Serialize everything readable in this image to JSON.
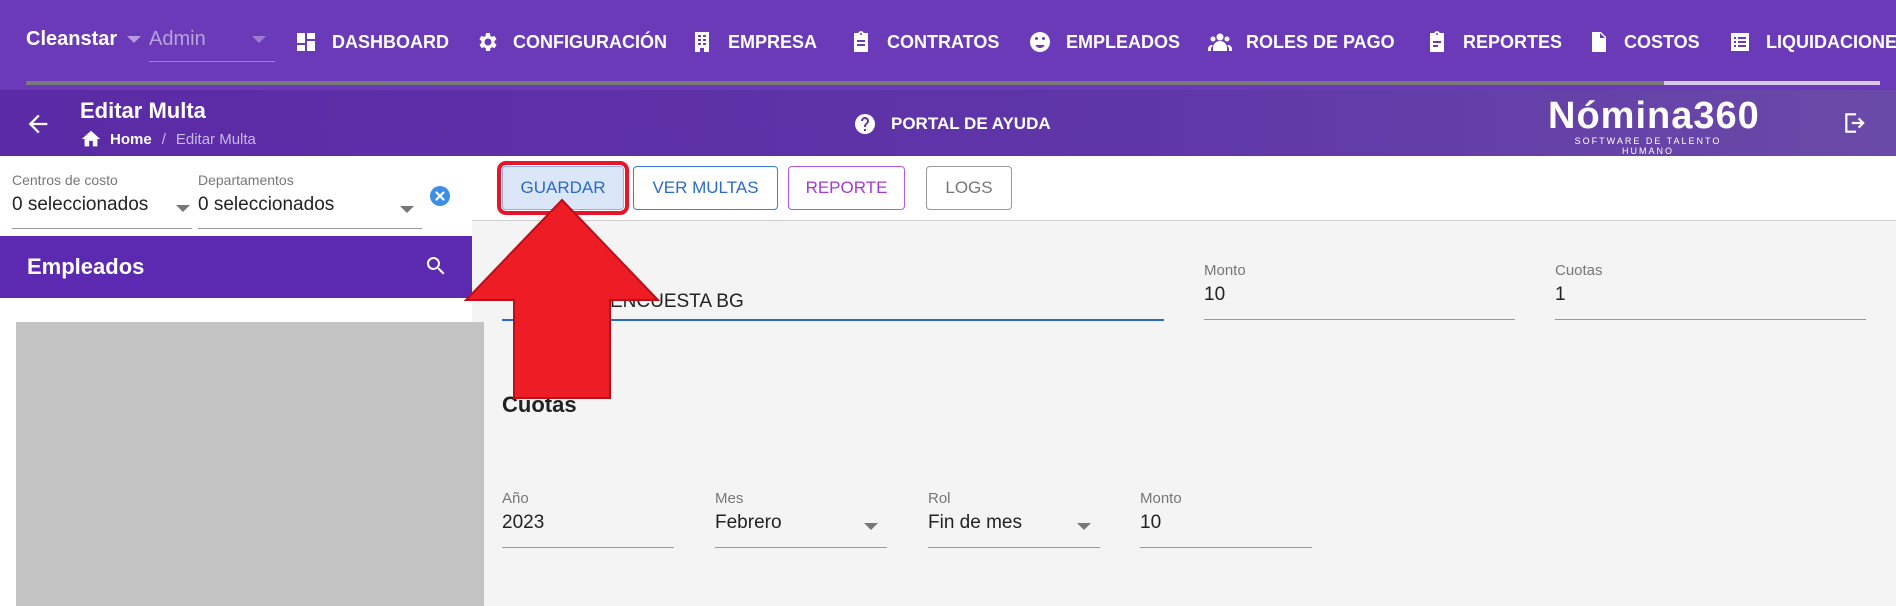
{
  "topbar": {
    "company": "Cleanstar",
    "role": "Admin",
    "menu": [
      {
        "label": "DASHBOARD",
        "icon": "dashboard-icon"
      },
      {
        "label": "CONFIGURACIÓN",
        "icon": "gear-icon"
      },
      {
        "label": "EMPRESA",
        "icon": "building-icon"
      },
      {
        "label": "CONTRATOS",
        "icon": "clipboard-icon"
      },
      {
        "label": "EMPLEADOS",
        "icon": "face-icon"
      },
      {
        "label": "ROLES DE PAGO",
        "icon": "group-icon"
      },
      {
        "label": "REPORTES",
        "icon": "report-icon"
      },
      {
        "label": "COSTOS",
        "icon": "dollar-file-icon"
      },
      {
        "label": "LIQUIDACIONE",
        "icon": "list-icon"
      }
    ]
  },
  "subbar": {
    "title": "Editar Multa",
    "breadcrumb_home": "Home",
    "breadcrumb_separator": "/",
    "breadcrumb_current": "Editar Multa",
    "help": "PORTAL DE AYUDA",
    "brand_name": "Nómina360",
    "brand_tagline": "SOFTWARE DE TALENTO HUMANO"
  },
  "filters": {
    "centros_label": "Centros de costo",
    "centros_value": "0 seleccionados",
    "departamentos_label": "Departamentos",
    "departamentos_value": "0 seleccionados"
  },
  "employees": {
    "title": "Empleados"
  },
  "toolbar": {
    "guardar": "GUARDAR",
    "ver_multas": "VER MULTAS",
    "reporte": "REPORTE",
    "logs": "LOGS"
  },
  "form": {
    "descripcion_value": "ENCUESTA BG",
    "monto_label": "Monto",
    "monto_value": "10",
    "cuotas_label": "Cuotas",
    "cuotas_value": "1"
  },
  "cuotas_section": {
    "title": "Cuotas",
    "anio_label": "Año",
    "anio_value": "2023",
    "mes_label": "Mes",
    "mes_value": "Febrero",
    "rol_label": "Rol",
    "rol_value": "Fin de mes",
    "monto_label": "Monto",
    "monto_value": "10"
  },
  "colors": {
    "nav_purple": "#6a3ab8",
    "sub_purple": "#5b2aa6",
    "primary_blue": "#2b6ac7",
    "accent_purple": "#a23ad6",
    "highlight_red": "#e8152a"
  }
}
